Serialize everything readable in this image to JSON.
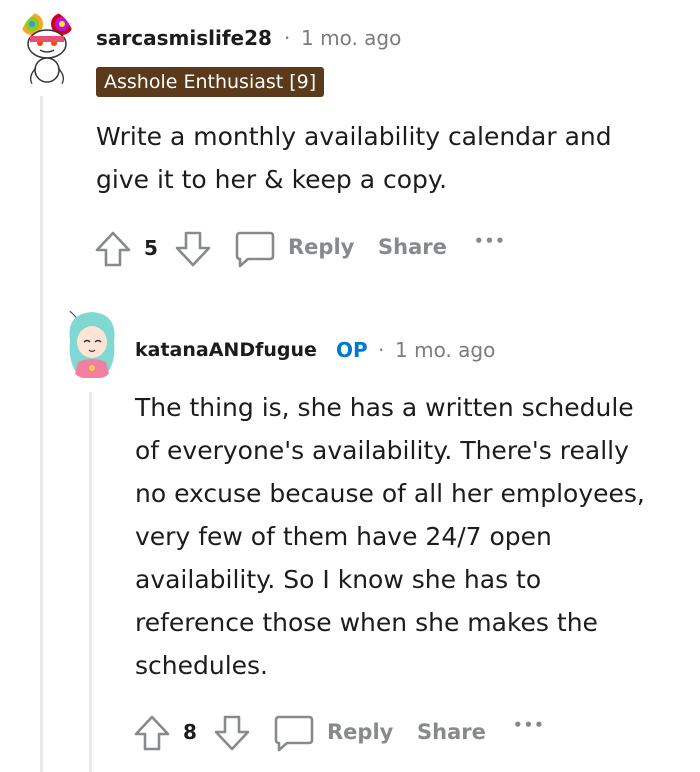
{
  "comments": [
    {
      "username": "sarcasmislife28",
      "separator": "·",
      "time": "1 mo. ago",
      "flair": "Asshole Enthusiast [9]",
      "body_lines": [
        "Write a monthly availability calendar and",
        "give it to her & keep a copy."
      ],
      "votes": "5",
      "reply_label": "Reply",
      "share_label": "Share",
      "more_label": "•••"
    },
    {
      "username": "katanaANDfugue",
      "op_label": "OP",
      "separator": "·",
      "time": "1 mo. ago",
      "body_lines": [
        "The thing is, she has a written schedule",
        "of everyone's availability. There's really",
        "no excuse because of all her employees,",
        "very few of them have 24/7 open",
        "availability. So I know she has to",
        "reference those when she makes the",
        "schedules."
      ],
      "votes": "8",
      "reply_label": "Reply",
      "share_label": "Share",
      "more_label": "•••"
    }
  ],
  "colors": {
    "text": "#1c1c1c",
    "meta": "#7c7c7c",
    "action": "#878a8c",
    "flair_bg": "#5a3a1a",
    "op": "#0079d3",
    "thread": "#e9eaeb"
  }
}
